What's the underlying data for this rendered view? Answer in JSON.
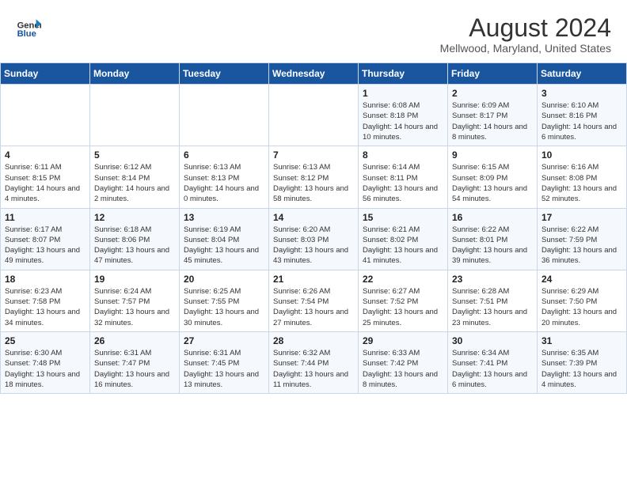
{
  "header": {
    "logo_line1": "General",
    "logo_line2": "Blue",
    "title": "August 2024",
    "subtitle": "Mellwood, Maryland, United States"
  },
  "days_of_week": [
    "Sunday",
    "Monday",
    "Tuesday",
    "Wednesday",
    "Thursday",
    "Friday",
    "Saturday"
  ],
  "weeks": [
    [
      {
        "day": "",
        "info": ""
      },
      {
        "day": "",
        "info": ""
      },
      {
        "day": "",
        "info": ""
      },
      {
        "day": "",
        "info": ""
      },
      {
        "day": "1",
        "info": "Sunrise: 6:08 AM\nSunset: 8:18 PM\nDaylight: 14 hours\nand 10 minutes."
      },
      {
        "day": "2",
        "info": "Sunrise: 6:09 AM\nSunset: 8:17 PM\nDaylight: 14 hours\nand 8 minutes."
      },
      {
        "day": "3",
        "info": "Sunrise: 6:10 AM\nSunset: 8:16 PM\nDaylight: 14 hours\nand 6 minutes."
      }
    ],
    [
      {
        "day": "4",
        "info": "Sunrise: 6:11 AM\nSunset: 8:15 PM\nDaylight: 14 hours\nand 4 minutes."
      },
      {
        "day": "5",
        "info": "Sunrise: 6:12 AM\nSunset: 8:14 PM\nDaylight: 14 hours\nand 2 minutes."
      },
      {
        "day": "6",
        "info": "Sunrise: 6:13 AM\nSunset: 8:13 PM\nDaylight: 14 hours\nand 0 minutes."
      },
      {
        "day": "7",
        "info": "Sunrise: 6:13 AM\nSunset: 8:12 PM\nDaylight: 13 hours\nand 58 minutes."
      },
      {
        "day": "8",
        "info": "Sunrise: 6:14 AM\nSunset: 8:11 PM\nDaylight: 13 hours\nand 56 minutes."
      },
      {
        "day": "9",
        "info": "Sunrise: 6:15 AM\nSunset: 8:09 PM\nDaylight: 13 hours\nand 54 minutes."
      },
      {
        "day": "10",
        "info": "Sunrise: 6:16 AM\nSunset: 8:08 PM\nDaylight: 13 hours\nand 52 minutes."
      }
    ],
    [
      {
        "day": "11",
        "info": "Sunrise: 6:17 AM\nSunset: 8:07 PM\nDaylight: 13 hours\nand 49 minutes."
      },
      {
        "day": "12",
        "info": "Sunrise: 6:18 AM\nSunset: 8:06 PM\nDaylight: 13 hours\nand 47 minutes."
      },
      {
        "day": "13",
        "info": "Sunrise: 6:19 AM\nSunset: 8:04 PM\nDaylight: 13 hours\nand 45 minutes."
      },
      {
        "day": "14",
        "info": "Sunrise: 6:20 AM\nSunset: 8:03 PM\nDaylight: 13 hours\nand 43 minutes."
      },
      {
        "day": "15",
        "info": "Sunrise: 6:21 AM\nSunset: 8:02 PM\nDaylight: 13 hours\nand 41 minutes."
      },
      {
        "day": "16",
        "info": "Sunrise: 6:22 AM\nSunset: 8:01 PM\nDaylight: 13 hours\nand 39 minutes."
      },
      {
        "day": "17",
        "info": "Sunrise: 6:22 AM\nSunset: 7:59 PM\nDaylight: 13 hours\nand 36 minutes."
      }
    ],
    [
      {
        "day": "18",
        "info": "Sunrise: 6:23 AM\nSunset: 7:58 PM\nDaylight: 13 hours\nand 34 minutes."
      },
      {
        "day": "19",
        "info": "Sunrise: 6:24 AM\nSunset: 7:57 PM\nDaylight: 13 hours\nand 32 minutes."
      },
      {
        "day": "20",
        "info": "Sunrise: 6:25 AM\nSunset: 7:55 PM\nDaylight: 13 hours\nand 30 minutes."
      },
      {
        "day": "21",
        "info": "Sunrise: 6:26 AM\nSunset: 7:54 PM\nDaylight: 13 hours\nand 27 minutes."
      },
      {
        "day": "22",
        "info": "Sunrise: 6:27 AM\nSunset: 7:52 PM\nDaylight: 13 hours\nand 25 minutes."
      },
      {
        "day": "23",
        "info": "Sunrise: 6:28 AM\nSunset: 7:51 PM\nDaylight: 13 hours\nand 23 minutes."
      },
      {
        "day": "24",
        "info": "Sunrise: 6:29 AM\nSunset: 7:50 PM\nDaylight: 13 hours\nand 20 minutes."
      }
    ],
    [
      {
        "day": "25",
        "info": "Sunrise: 6:30 AM\nSunset: 7:48 PM\nDaylight: 13 hours\nand 18 minutes."
      },
      {
        "day": "26",
        "info": "Sunrise: 6:31 AM\nSunset: 7:47 PM\nDaylight: 13 hours\nand 16 minutes."
      },
      {
        "day": "27",
        "info": "Sunrise: 6:31 AM\nSunset: 7:45 PM\nDaylight: 13 hours\nand 13 minutes."
      },
      {
        "day": "28",
        "info": "Sunrise: 6:32 AM\nSunset: 7:44 PM\nDaylight: 13 hours\nand 11 minutes."
      },
      {
        "day": "29",
        "info": "Sunrise: 6:33 AM\nSunset: 7:42 PM\nDaylight: 13 hours\nand 8 minutes."
      },
      {
        "day": "30",
        "info": "Sunrise: 6:34 AM\nSunset: 7:41 PM\nDaylight: 13 hours\nand 6 minutes."
      },
      {
        "day": "31",
        "info": "Sunrise: 6:35 AM\nSunset: 7:39 PM\nDaylight: 13 hours\nand 4 minutes."
      }
    ]
  ]
}
